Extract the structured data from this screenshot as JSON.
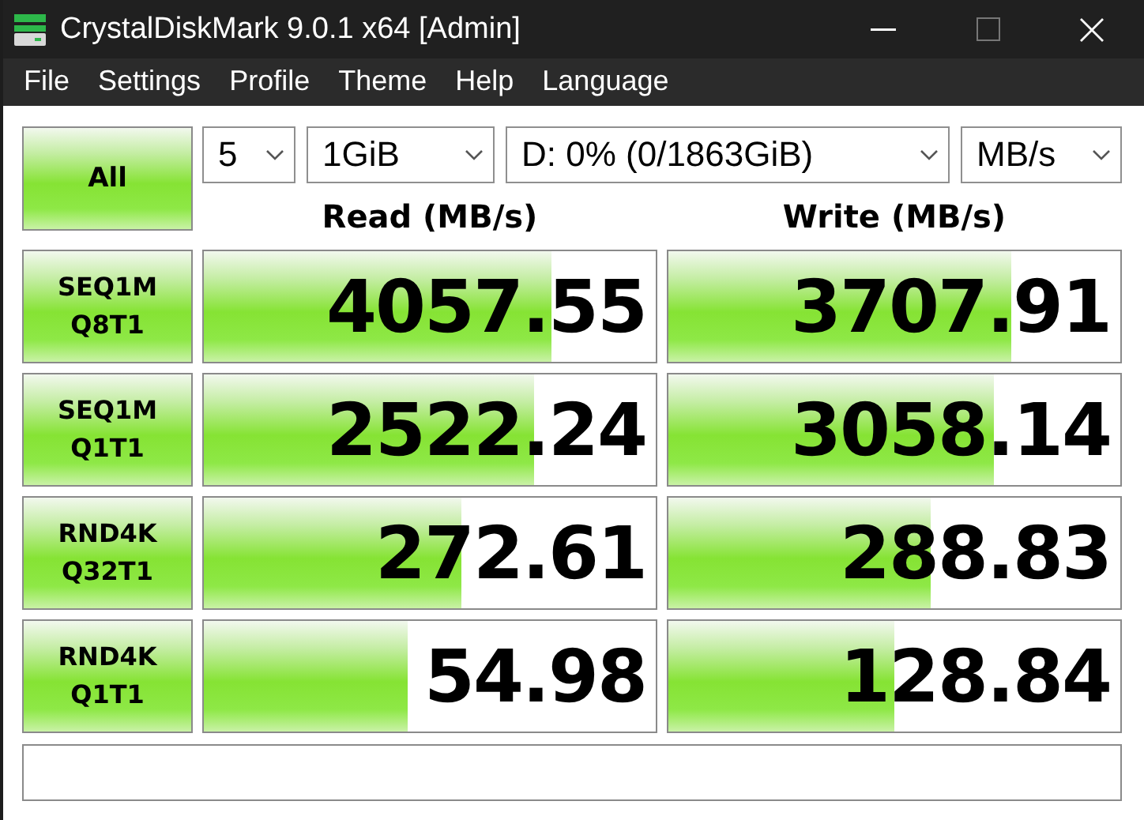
{
  "window": {
    "title": "CrystalDiskMark 9.0.1 x64 [Admin]"
  },
  "menu": [
    "File",
    "Settings",
    "Profile",
    "Theme",
    "Help",
    "Language"
  ],
  "all_button": "All",
  "selectors": [
    {
      "value": "5"
    },
    {
      "value": "1GiB"
    },
    {
      "value": "D: 0% (0/1863GiB)"
    },
    {
      "value": "MB/s"
    }
  ],
  "headers": [
    "Read (MB/s)",
    "Write (MB/s)"
  ],
  "tests": [
    {
      "label": "SEQ1M",
      "sublabel": "Q8T1",
      "read": {
        "value": "4057.55",
        "level": 0.77
      },
      "write": {
        "value": "3707.91",
        "level": 0.76
      }
    },
    {
      "label": "SEQ1M",
      "sublabel": "Q1T1",
      "read": {
        "value": "2522.24",
        "level": 0.73
      },
      "write": {
        "value": "3058.14",
        "level": 0.72
      }
    },
    {
      "label": "RND4K",
      "sublabel": "Q32T1",
      "read": {
        "value": "272.61",
        "level": 0.57
      },
      "write": {
        "value": "288.83",
        "level": 0.58
      }
    },
    {
      "label": "RND4K",
      "sublabel": "Q1T1",
      "read": {
        "value": "54.98",
        "level": 0.45
      },
      "write": {
        "value": "128.84",
        "level": 0.5
      }
    }
  ]
}
